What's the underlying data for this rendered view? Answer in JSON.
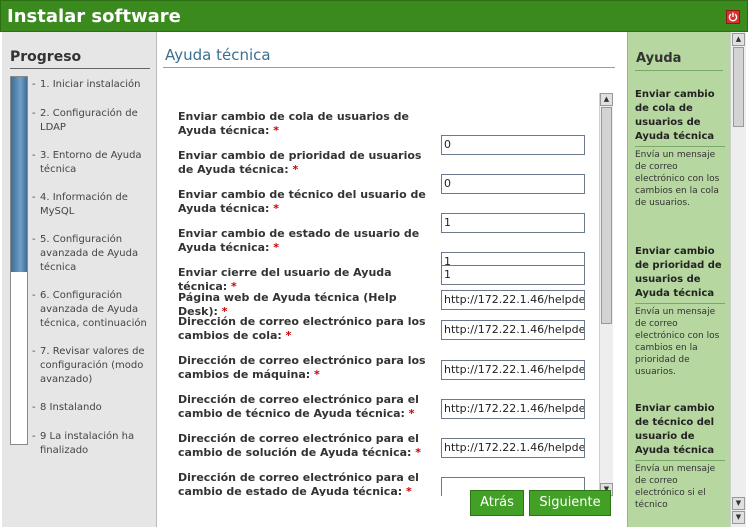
{
  "window": {
    "title": "Instalar software",
    "close_icon": "power-close-icon"
  },
  "sidebar": {
    "heading": "Progreso",
    "progress_fraction": 0.53,
    "steps": [
      {
        "dash": "-",
        "label": "1. Iniciar instalación"
      },
      {
        "dash": "-",
        "label": "2. Configuración de LDAP"
      },
      {
        "dash": "-",
        "label": "3. Entorno de Ayuda técnica"
      },
      {
        "dash": "-",
        "label": "4. Información de MySQL"
      },
      {
        "dash": "-",
        "label": "5. Configuración avanzada de Ayuda técnica"
      },
      {
        "dash": "-",
        "label": "6. Configuración avanzada de Ayuda técnica, continuación"
      },
      {
        "dash": "-",
        "label": "7. Revisar valores de configuración (modo avanzado)"
      },
      {
        "dash": "-",
        "label": "8 Instalando"
      },
      {
        "dash": "-",
        "label": "9 La instalación ha finalizado"
      }
    ]
  },
  "main": {
    "title": "Ayuda técnica",
    "required_mark": "*",
    "fields": [
      {
        "label": "Enviar cambio de cola de usuarios de Ayuda técnica:",
        "value": "0"
      },
      {
        "label": "Enviar cambio de prioridad de usuarios de Ayuda técnica:",
        "value": "0"
      },
      {
        "label": "Enviar cambio de técnico del usuario de Ayuda técnica:",
        "value": "1"
      },
      {
        "label": "Enviar cambio de estado de usuario de Ayuda técnica:",
        "value": "1"
      },
      {
        "label": "Enviar cierre del usuario de Ayuda técnica:",
        "value": "1"
      },
      {
        "label": "Página web de Ayuda técnica (Help Desk):",
        "value": "http://172.22.1.46/helpde"
      },
      {
        "label": "Dirección de correo electrónico para los cambios de cola:",
        "value": "http://172.22.1.46/helpde"
      },
      {
        "label": "Dirección de correo electrónico para los cambios de máquina:",
        "value": "http://172.22.1.46/helpde"
      },
      {
        "label": "Dirección de correo electrónico para el cambio de técnico de Ayuda técnica:",
        "value": "http://172.22.1.46/helpde"
      },
      {
        "label": "Dirección de correo electrónico para el cambio de solución de Ayuda técnica:",
        "value": "http://172.22.1.46/helpde"
      },
      {
        "label": "Dirección de correo electrónico para el cambio de estado de Ayuda técnica:",
        "value": ""
      }
    ],
    "buttons": {
      "back": "Atrás",
      "next": "Siguiente"
    }
  },
  "help": {
    "title": "Ayuda",
    "sections": [
      {
        "heading": "Enviar cambio de cola de usuarios de Ayuda técnica",
        "body": "Envía un mensaje de correo electrónico con los cambios en la cola de usuarios."
      },
      {
        "heading": "Enviar cambio de prioridad de usuarios de Ayuda técnica",
        "body": "Envía un mensaje de correo electrónico con los cambios en la prioridad de usuarios."
      },
      {
        "heading": "Enviar cambio de técnico del usuario de Ayuda técnica",
        "body": "Envía un mensaje de correo electrónico si el técnico"
      }
    ]
  }
}
